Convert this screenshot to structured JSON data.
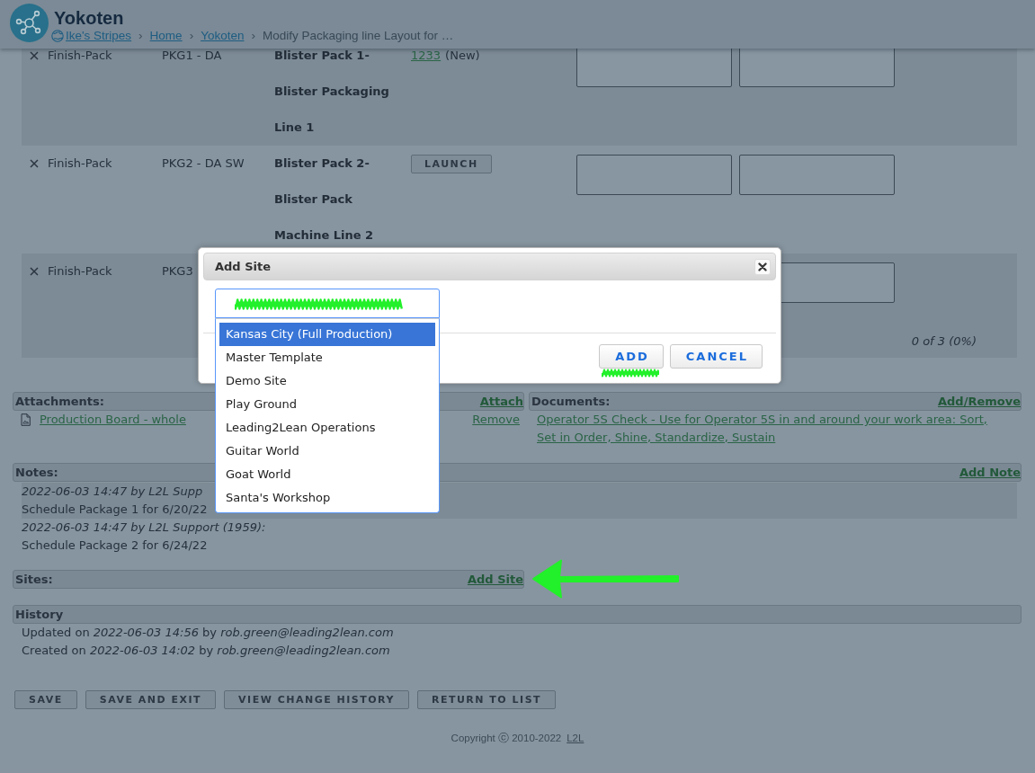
{
  "header": {
    "title": "Yokoten",
    "breadcrumb": [
      {
        "kind": "site",
        "label": "Ike's Stripes"
      },
      {
        "kind": "separator",
        "label": "›"
      },
      {
        "kind": "link",
        "label": "Home"
      },
      {
        "kind": "separator",
        "label": "›"
      },
      {
        "kind": "link",
        "label": "Yokoten"
      },
      {
        "kind": "separator",
        "label": "›"
      },
      {
        "kind": "current",
        "label": "Modify Packaging line Layout for …"
      }
    ]
  },
  "table": {
    "rows": [
      {
        "area": "Finish-Pack",
        "code": "PKG1 - DA",
        "line": "Blister Pack 1-Blister Packaging Line 1",
        "action": {
          "kind": "link",
          "label": "1233",
          "status": "(New)"
        }
      },
      {
        "area": "Finish-Pack",
        "code": "PKG2 - DA SW",
        "line": "Blister Pack 2-Blister Pack Machine Line 2",
        "action": {
          "kind": "button",
          "label": "LAUNCH"
        }
      },
      {
        "area": "Finish-Pack",
        "code": "PKG3"
      }
    ],
    "summary": "0 of 3 (0%)"
  },
  "attachments": {
    "title": "Attachments:",
    "action": "Attach",
    "items": [
      {
        "label": "Production Board - whole",
        "remove": "Remove"
      }
    ]
  },
  "documents": {
    "title": "Documents:",
    "action": "Add/Remove",
    "items": [
      "Operator 5S Check - Use for Operator 5S in and around your work area: Sort, Set in Order, Shine, Standardize, Sustain"
    ]
  },
  "notes": {
    "title": "Notes:",
    "action": "Add Note",
    "items": [
      {
        "meta": "2022-06-03 14:47 by L2L Supp",
        "text": "Schedule Package 1 for 6/20/22"
      },
      {
        "meta": "2022-06-03 14:47 by L2L Support (1959):",
        "text": "Schedule Package 2 for 6/24/22"
      }
    ]
  },
  "sites": {
    "title": "Sites:",
    "action": "Add Site"
  },
  "history": {
    "title": "History",
    "entries": [
      "Updated on *2022-06-03 14:56* by *rob.green@leading2lean.com*",
      "Created on *2022-06-03 14:02* by *rob.green@leading2lean.com*"
    ]
  },
  "buttons": [
    "SAVE",
    "SAVE AND EXIT",
    "VIEW CHANGE HISTORY",
    "RETURN TO LIST"
  ],
  "footer": {
    "text": "Copyright ⓒ 2010-2022",
    "link": "L2L"
  },
  "dialog": {
    "title": "Add Site",
    "site_select": {
      "expanded": true,
      "options": [
        {
          "label": "Kansas City (Full Production)",
          "selected": true
        },
        {
          "label": "Master Template",
          "selected": false
        },
        {
          "label": "Demo Site",
          "selected": false
        },
        {
          "label": "Play Ground",
          "selected": false
        },
        {
          "label": "Leading2Lean Operations",
          "selected": false
        },
        {
          "label": "Guitar World",
          "selected": false
        },
        {
          "label": "Goat World",
          "selected": false
        },
        {
          "label": "Santa's Workshop",
          "selected": false
        }
      ]
    },
    "buttons": [
      "ADD",
      "CANCEL"
    ]
  }
}
